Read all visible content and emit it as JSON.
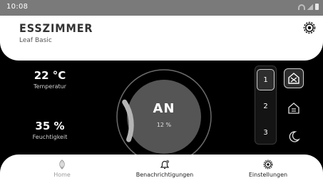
{
  "status_bar": {
    "time": "10:08"
  },
  "room": {
    "name": "ESSZIMMER",
    "device": "Leaf Basic"
  },
  "stats": {
    "temperature": {
      "value": "22 °C",
      "label": "Temperatur"
    },
    "humidity": {
      "value": "35 %",
      "label": "Feuchtigkeit"
    }
  },
  "dial": {
    "state": "AN",
    "percent_label": "12 %",
    "level": 0.12
  },
  "levels": {
    "items": [
      "1",
      "2",
      "3"
    ],
    "selected": "1"
  },
  "modes": {
    "selected": "auto-mode"
  },
  "nav": {
    "home": "Home",
    "notifications": "Benachrichtigungen",
    "settings": "Einstellungen"
  },
  "colors": {
    "accent": "#6b6b6b",
    "dial_fill": "#555555",
    "background": "#000000"
  }
}
